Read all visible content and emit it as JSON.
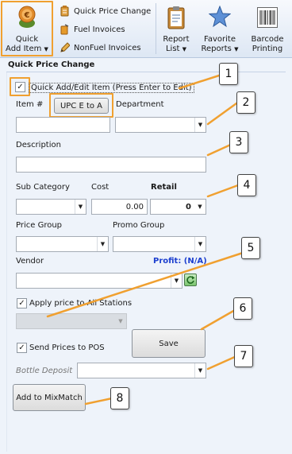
{
  "ribbon": {
    "quick_add_label_line1": "Quick",
    "quick_add_label_line2": "Add Item",
    "quick_price_change": "Quick Price Change",
    "fuel_invoices": "Fuel Invoices",
    "nonfuel_invoices": "NonFuel Invoices",
    "report_list_line1": "Report",
    "report_list_line2": "List",
    "favorite_reports_line1": "Favorite",
    "favorite_reports_line2": "Reports",
    "barcode_printing_line1": "Barcode",
    "barcode_printing_line2": "Printing",
    "dropdown_glyph": "▼"
  },
  "form": {
    "title": "Quick Price Change",
    "quick_add_checkbox_label": "Quick Add/Edit Item (Press Enter to Edit)",
    "quick_add_checked": "✓",
    "item_label": "Item #",
    "upc_button": "UPC E to A",
    "department_label": "Department",
    "item_value": "",
    "department_value": "",
    "description_label": "Description",
    "description_value": "",
    "sub_category_label": "Sub Category",
    "cost_label": "Cost",
    "retail_label": "Retail",
    "sub_category_value": "",
    "cost_value": "0.00",
    "retail_value": "0",
    "price_group_label": "Price Group",
    "promo_group_label": "Promo Group",
    "price_group_value": "",
    "promo_group_value": "",
    "vendor_label": "Vendor",
    "profit_label": "Profit: (N/A)",
    "vendor_value": "",
    "apply_all_label": "Apply price to All Stations",
    "apply_all_checked": "✓",
    "station_value": "",
    "send_prices_label": "Send Prices to POS",
    "send_prices_checked": "✓",
    "save_button": "Save",
    "bottle_deposit_label": "Bottle Deposit",
    "bottle_deposit_value": "",
    "mixmatch_button": "Add to MixMatch",
    "dropdown_glyph": "▼"
  },
  "callouts": [
    "1",
    "2",
    "3",
    "4",
    "5",
    "6",
    "7",
    "8"
  ],
  "colors": {
    "highlight": "#f0a030",
    "profit_text": "#1c3fcf",
    "background": "#eef3fa"
  }
}
